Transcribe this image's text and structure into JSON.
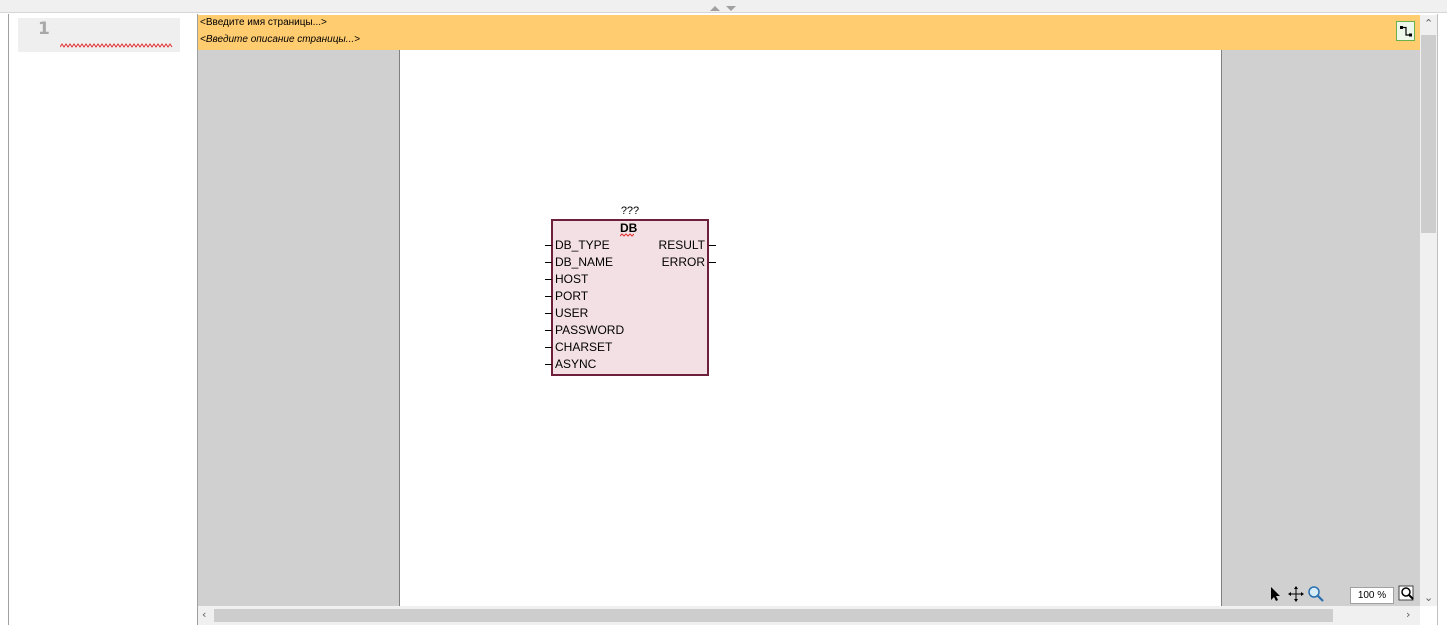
{
  "page_list": {
    "page_number": "1"
  },
  "header": {
    "name_placeholder": "<Введите имя страницы...>",
    "description_placeholder": "<Введите описание страницы...>"
  },
  "block": {
    "instance_name": "???",
    "type_name": "DB",
    "inputs": [
      "DB_TYPE",
      "DB_NAME",
      "HOST",
      "PORT",
      "USER",
      "PASSWORD",
      "CHARSET",
      "ASYNC"
    ],
    "outputs": [
      "RESULT",
      "ERROR"
    ]
  },
  "toolbar": {
    "zoom": "100 %",
    "icons": [
      "pointer-icon",
      "pan-icon",
      "zoom-icon",
      "zoom-settings-icon"
    ]
  },
  "colors": {
    "header_bg": "#ffcc70",
    "block_fill": "#f3e0e4",
    "block_border": "#6e1f3b",
    "canvas_bg": "#d0d0d0"
  }
}
